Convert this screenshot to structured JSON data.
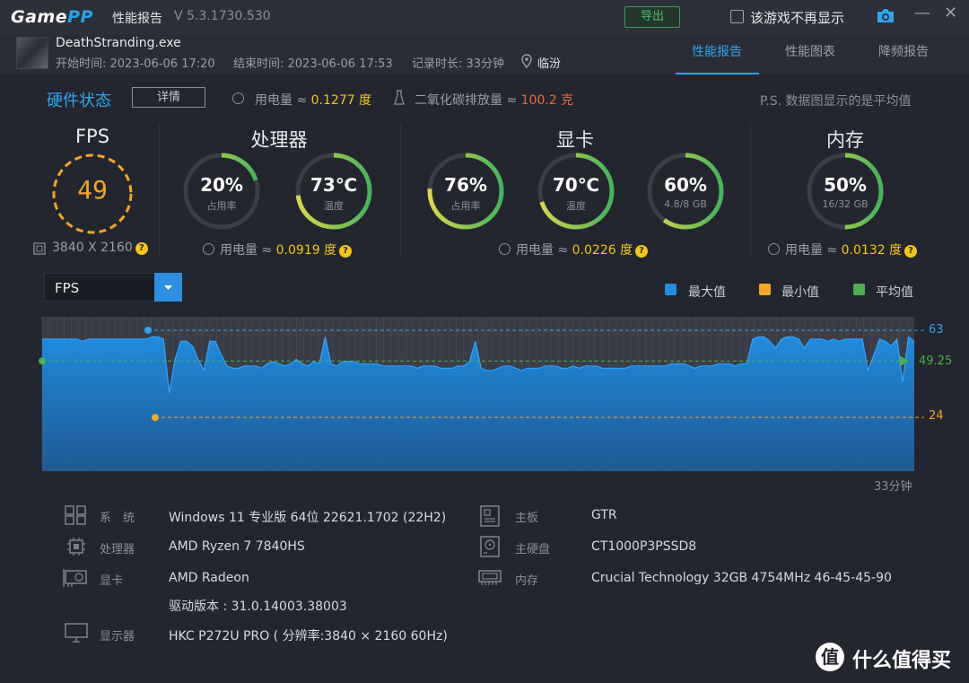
{
  "app": {
    "logo_game": "Game",
    "logo_pp": "PP",
    "title": "性能报告",
    "version": "V 5.3.1730.530",
    "export_label": "导出",
    "dont_show_label": "该游戏不再显示",
    "minimize": "—",
    "close": "✕"
  },
  "session": {
    "process": "DeathStranding.exe",
    "start": "开始时间: 2023-06-06 17:20",
    "end": "结束时间: 2023-06-06 17:53",
    "duration": "记录时长: 33分钟",
    "location": "临汾"
  },
  "tabs": [
    {
      "label": "性能报告",
      "active": true
    },
    {
      "label": "性能图表",
      "active": false
    },
    {
      "label": "降频报告",
      "active": false
    }
  ],
  "status": {
    "title": "硬件状态",
    "detail_btn": "详情",
    "power_label": "用电量 ≈",
    "power_value": "0.1277 度",
    "co2_label": "二氧化碳排放量 ≈",
    "co2_value": "100.2 克",
    "ps_note": "P.S. 数据图显示的是平均值"
  },
  "fps": {
    "title": "FPS",
    "value": "49",
    "resolution": "3840 X 2160"
  },
  "cpu": {
    "title": "处理器",
    "usage_value": "20%",
    "usage_label": "占用率",
    "usage_frac": 0.2,
    "temp_value": "73℃",
    "temp_label": "温度",
    "temp_frac": 0.73,
    "power_label": "用电量 ≈",
    "power_value": "0.0919 度"
  },
  "gpu": {
    "title": "显卡",
    "usage_value": "76%",
    "usage_label": "占用率",
    "usage_frac": 0.76,
    "temp_value": "70℃",
    "temp_label": "温度",
    "temp_frac": 0.7,
    "vram_value": "60%",
    "vram_label": "4.8/8 GB",
    "vram_frac": 0.6,
    "power_label": "用电量 ≈",
    "power_value": "0.0226 度"
  },
  "memory": {
    "title": "内存",
    "usage_value": "50%",
    "usage_label": "16/32 GB",
    "usage_frac": 0.5,
    "power_label": "用电量 ≈",
    "power_value": "0.0132 度"
  },
  "chart_controls": {
    "metric": "FPS",
    "legend": [
      {
        "label": "最大值",
        "color": "#1e8fe6"
      },
      {
        "label": "最小值",
        "color": "#f5a623"
      },
      {
        "label": "平均值",
        "color": "#4caf50"
      }
    ]
  },
  "chart_data": {
    "type": "area",
    "ylim": [
      0,
      63
    ],
    "max": 63,
    "min": 24,
    "avg": 49.25,
    "max_label": "63",
    "min_label": "24",
    "avg_label": "49.25",
    "x_end_label": "33分钟",
    "values": [
      59,
      59,
      59,
      59,
      59,
      59,
      59,
      58,
      59,
      59,
      59,
      59,
      59,
      59,
      59,
      59,
      59,
      59,
      59,
      60,
      60,
      59,
      35,
      50,
      58,
      58,
      56,
      50,
      45,
      58,
      58,
      52,
      47,
      46,
      46,
      47,
      47,
      47,
      46,
      48,
      49,
      48,
      47,
      48,
      50,
      48,
      47,
      49,
      48,
      60,
      48,
      47,
      49,
      49,
      49,
      48,
      48,
      48,
      48,
      47,
      47,
      47,
      47,
      47,
      47,
      46,
      47,
      47,
      47,
      46,
      46,
      46,
      47,
      47,
      49,
      58,
      46,
      45,
      45,
      46,
      47,
      47,
      46,
      45,
      46,
      46,
      46,
      47,
      47,
      47,
      46,
      46,
      47,
      46,
      47,
      47,
      47,
      46,
      46,
      46,
      46,
      46,
      47,
      47,
      47,
      47,
      47,
      47,
      47,
      48,
      48,
      48,
      47,
      46,
      47,
      47,
      47,
      48,
      48,
      48,
      47,
      48,
      48,
      59,
      60,
      60,
      58,
      55,
      59,
      60,
      60,
      59,
      55,
      59,
      59,
      59,
      58,
      59,
      58,
      59,
      59,
      59,
      59,
      45,
      52,
      59,
      58,
      56,
      59,
      40,
      60,
      58
    ]
  },
  "system_info": {
    "os_label": "系　统",
    "os_value": "Windows 11 专业版 64位 22621.1702 (22H2)",
    "cpu_label": "处理器",
    "cpu_value": "AMD Ryzen 7 7840HS",
    "gpu_label": "显卡",
    "gpu_value": "AMD Radeon",
    "driver_value": "驱动版本 : 31.0.14003.38003",
    "display_label": "显示器",
    "display_value": "HKC P272U PRO ( 分辨率:3840 × 2160 60Hz)",
    "board_label": "主板",
    "board_value": "GTR",
    "disk_label": "主硬盘",
    "disk_value": "CT1000P3PSSD8",
    "ram_label": "内存",
    "ram_value": "Crucial Technology 32GB 4754MHz 46-45-45-90"
  },
  "watermark": {
    "icon": "值",
    "text": "什么值得买"
  }
}
